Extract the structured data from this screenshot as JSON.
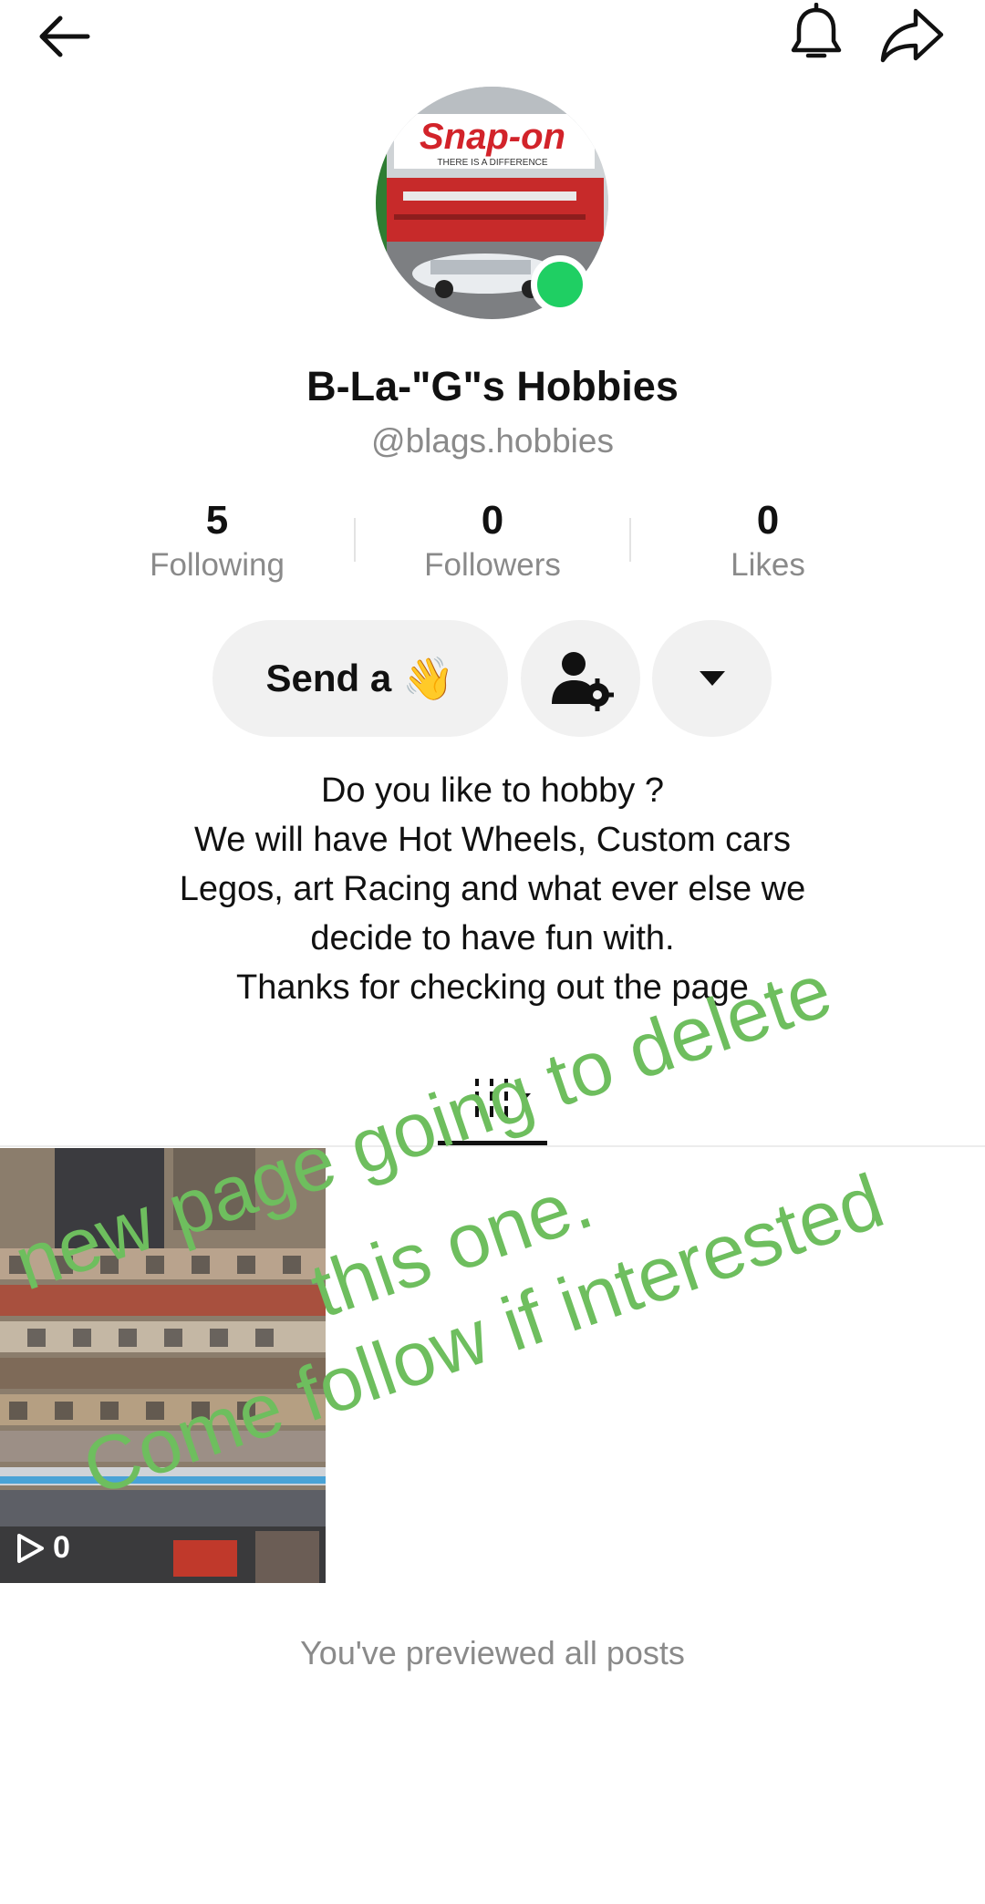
{
  "profile": {
    "display_name": "B-La-\"G\"s Hobbies",
    "username": "@blags.hobbies",
    "online_color": "#1fcf63"
  },
  "stats": [
    {
      "value": "5",
      "label": "Following"
    },
    {
      "value": "0",
      "label": "Followers"
    },
    {
      "value": "0",
      "label": "Likes"
    }
  ],
  "actions": {
    "send_label": "Send a",
    "send_emoji": "👋"
  },
  "bio": [
    "Do you like to hobby ?",
    "We will have Hot Wheels, Custom cars",
    "Legos, art Racing and what ever else we",
    "decide to have fun with.",
    "Thanks for checking out the page"
  ],
  "posts": [
    {
      "views": "0"
    }
  ],
  "footer": {
    "end_text": "You've previewed all posts"
  },
  "overlay": {
    "line1": "new page going to delete",
    "line2": "this one.",
    "line3": "Come follow if interested",
    "color": "#6ebe5e"
  },
  "icons": {
    "back": "arrow-left-icon",
    "bell": "bell-icon",
    "share": "share-icon",
    "friend_settings": "user-gear-icon",
    "dropdown": "caret-down-icon",
    "tab": "grid-bars-icon",
    "play": "play-icon"
  }
}
